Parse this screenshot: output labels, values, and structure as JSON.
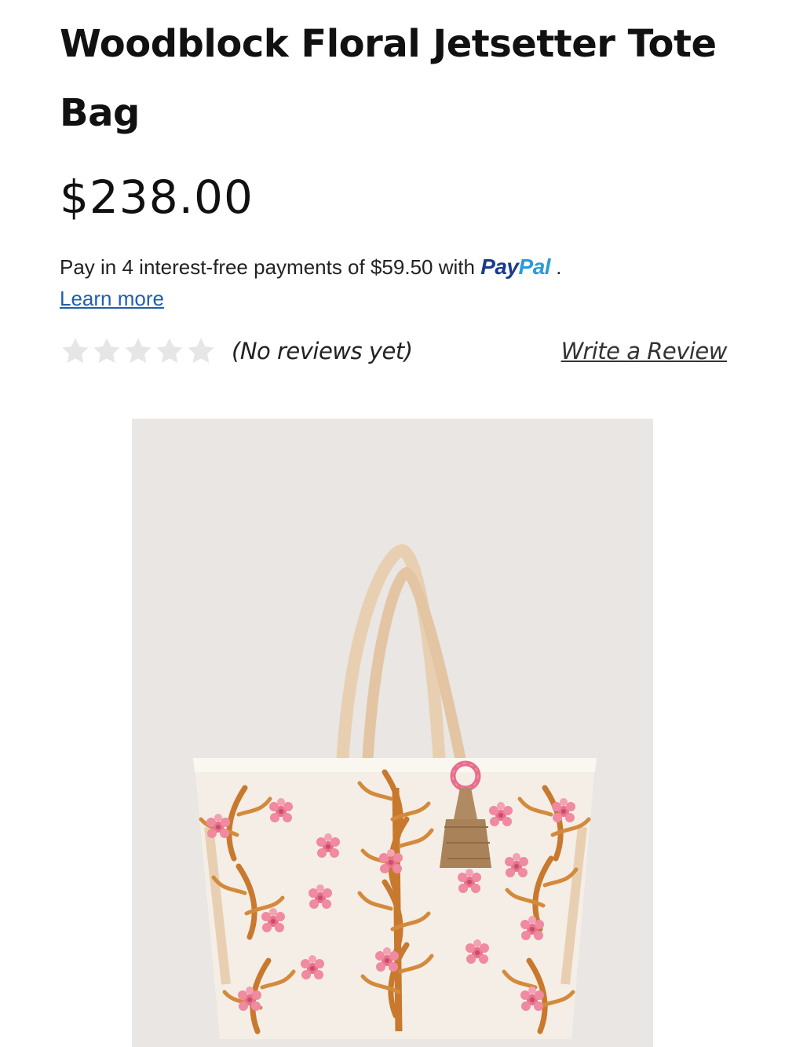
{
  "product": {
    "title": "Woodblock Floral Jetsetter Tote Bag",
    "price": "$238.00"
  },
  "payment": {
    "installment_text": "Pay in 4 interest-free payments of $59.50 with ",
    "paypal_part1": "Pay",
    "paypal_part2": "Pal",
    "trailing": " .",
    "learn_more": "Learn more"
  },
  "reviews": {
    "rating": 0,
    "max_rating": 5,
    "summary": "(No reviews yet)",
    "write_review": "Write a Review"
  },
  "colors": {
    "paypal_dark": "#1b3a8c",
    "paypal_light": "#2a9bd8",
    "link": "#1f5fae",
    "star_empty": "#e6e6e6",
    "image_background": "#e9e6e3"
  }
}
